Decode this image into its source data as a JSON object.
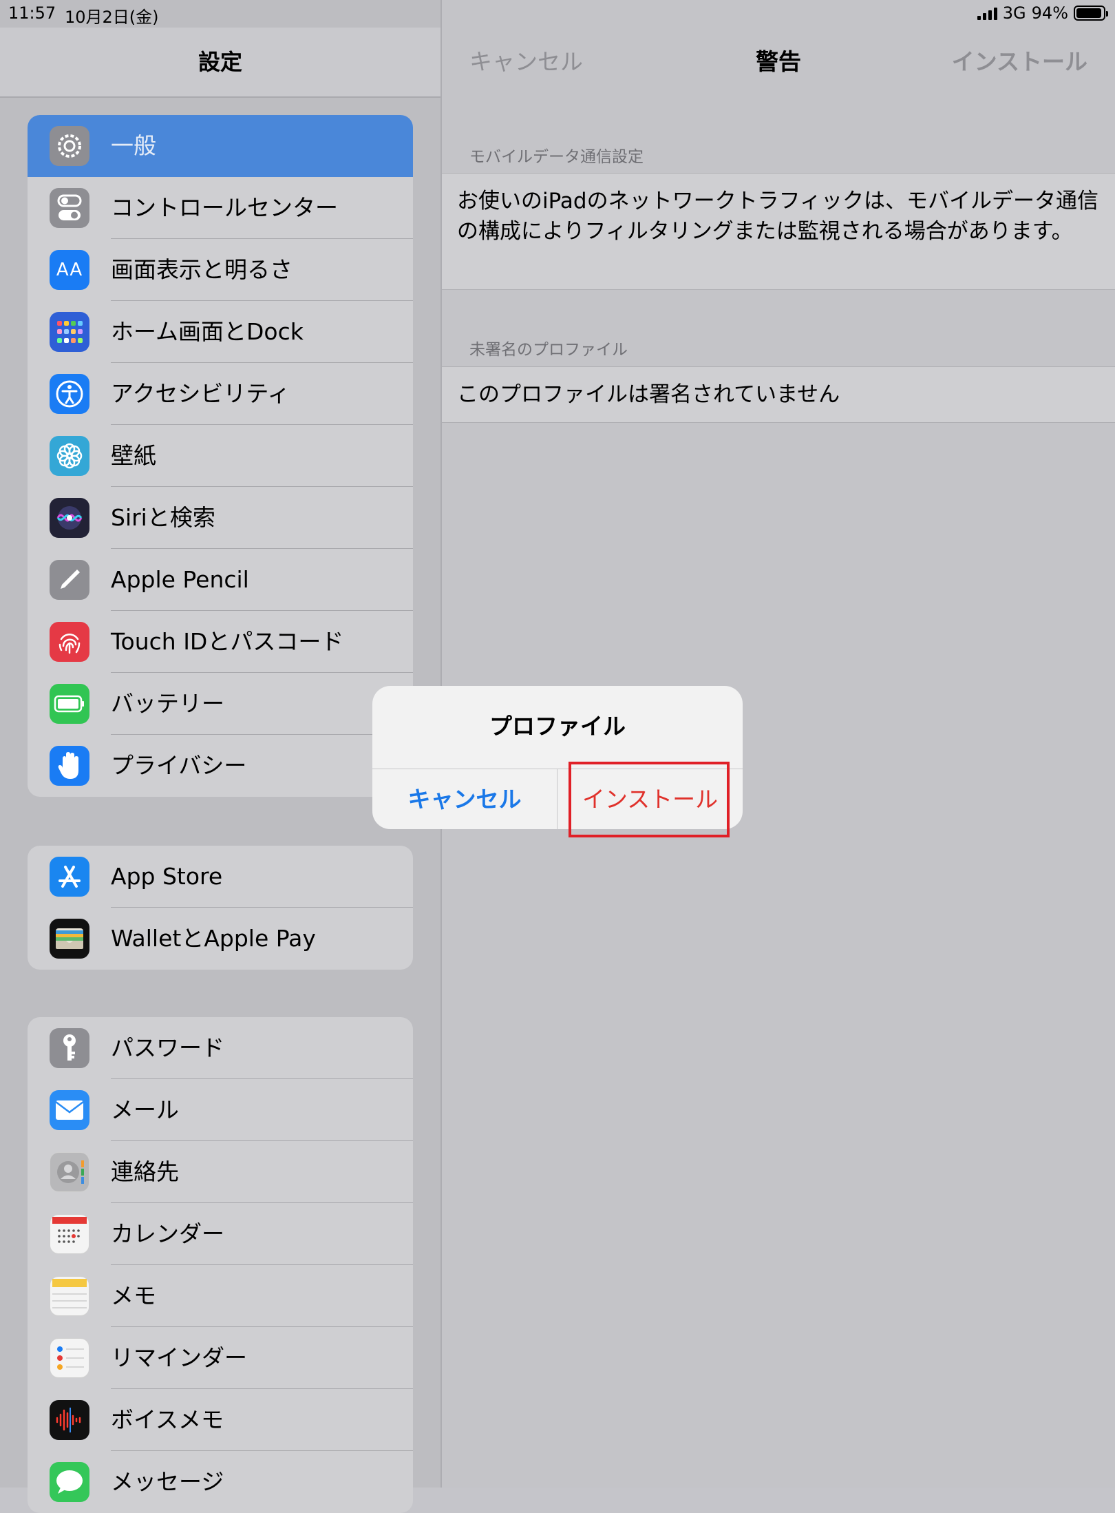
{
  "status": {
    "time": "11:57",
    "date": "10月2日(金)",
    "network": "3G",
    "battery": "94%",
    "battery_level": 0.94
  },
  "sidebar": {
    "title": "設定",
    "groups": [
      {
        "items": [
          {
            "label": "一般",
            "icon": "gear-icon",
            "color": "#8e8e93",
            "selected": true
          },
          {
            "label": "コントロールセンター",
            "icon": "toggle-icon",
            "color": "#8e8e93"
          },
          {
            "label": "画面表示と明るさ",
            "icon": "text-size-icon",
            "color": "#1a7cf4"
          },
          {
            "label": "ホーム画面とDock",
            "icon": "app-grid-icon",
            "color": "#2e5fd6"
          },
          {
            "label": "アクセシビリティ",
            "icon": "accessibility-icon",
            "color": "#1a7cf4"
          },
          {
            "label": "壁紙",
            "icon": "flower-icon",
            "color": "#34a7d6"
          },
          {
            "label": "Siriと検索",
            "icon": "siri-icon",
            "color": "#222236"
          },
          {
            "label": "Apple Pencil",
            "icon": "pencil-icon",
            "color": "#8e8e93"
          },
          {
            "label": "Touch IDとパスコード",
            "icon": "fingerprint-icon",
            "color": "#e53945"
          },
          {
            "label": "バッテリー",
            "icon": "battery-icon",
            "color": "#31c553"
          },
          {
            "label": "プライバシー",
            "icon": "hand-icon",
            "color": "#1a7cf4"
          }
        ]
      },
      {
        "items": [
          {
            "label": "App Store",
            "icon": "app-store-icon",
            "color": "#1a86f0"
          },
          {
            "label": "WalletとApple Pay",
            "icon": "wallet-icon",
            "color": "#111111"
          }
        ]
      },
      {
        "items": [
          {
            "label": "パスワード",
            "icon": "key-icon",
            "color": "#8e8e93"
          },
          {
            "label": "メール",
            "icon": "mail-icon",
            "color": "#2a8df5"
          },
          {
            "label": "連絡先",
            "icon": "contacts-icon",
            "color": "#b8b8ba"
          },
          {
            "label": "カレンダー",
            "icon": "calendar-icon",
            "color": "#f4f4f4"
          },
          {
            "label": "メモ",
            "icon": "notes-icon",
            "color": "#f4f4f4"
          },
          {
            "label": "リマインダー",
            "icon": "reminders-icon",
            "color": "#f4f4f4"
          },
          {
            "label": "ボイスメモ",
            "icon": "voice-memo-icon",
            "color": "#111111"
          },
          {
            "label": "メッセージ",
            "icon": "messages-icon",
            "color": "#34c759"
          }
        ]
      }
    ]
  },
  "detail": {
    "cancel": "キャンセル",
    "title": "警告",
    "install": "インストール",
    "sections": [
      {
        "header": "モバイルデータ通信設定",
        "body": "お使いのiPadのネットワークトラフィックは、モバイルデータ通信の構成によりフィルタリングまたは監視される場合があります。"
      },
      {
        "header": "未署名のプロファイル",
        "body": "このプロファイルは署名されていません"
      }
    ]
  },
  "alert": {
    "title": "プロファイル",
    "cancel": "キャンセル",
    "install": "インストール"
  }
}
